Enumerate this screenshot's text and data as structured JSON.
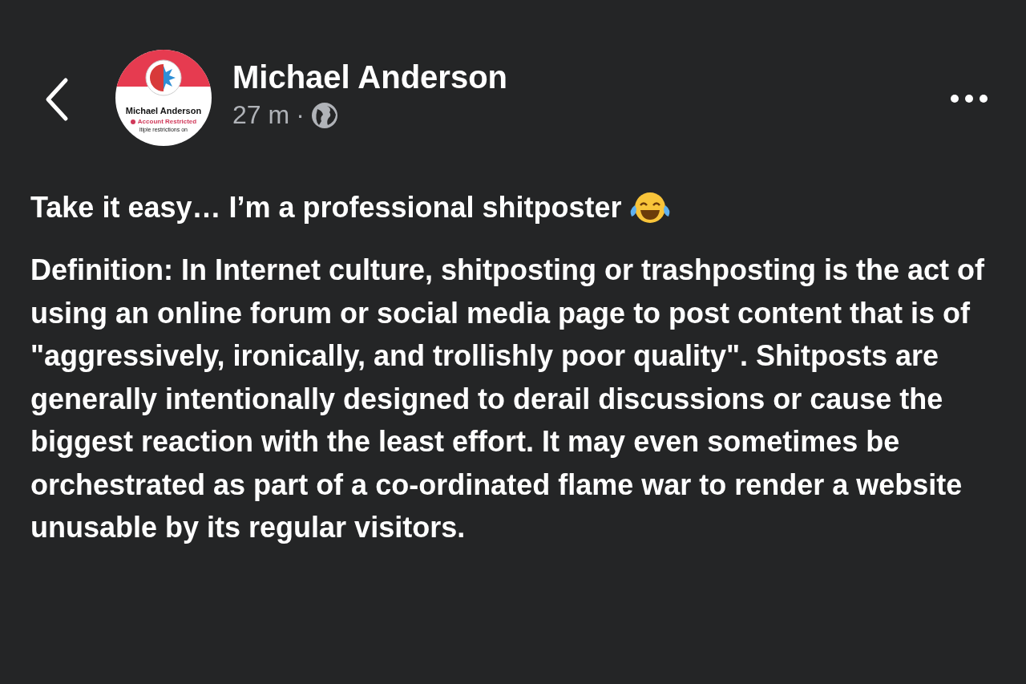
{
  "post": {
    "author": "Michael Anderson",
    "time": "27 m",
    "separator": "·",
    "avatar": {
      "name": "Michael Anderson",
      "status": "Account Restricted",
      "note": "ltiple restrictions on"
    },
    "first_line": "Take it easy… I’m a professional shitposter",
    "body": "Definition: In Internet culture, shitposting or trashposting is the act of using an online forum or social media page to post content that is of \"aggressively, ironically, and trollishly poor quality\". Shitposts are generally intentionally designed to derail discussions or cause the biggest reaction with the least effort. It may even sometimes be orchestrated as part of a co-ordinated flame war to render a website unusable by its regular visitors."
  }
}
